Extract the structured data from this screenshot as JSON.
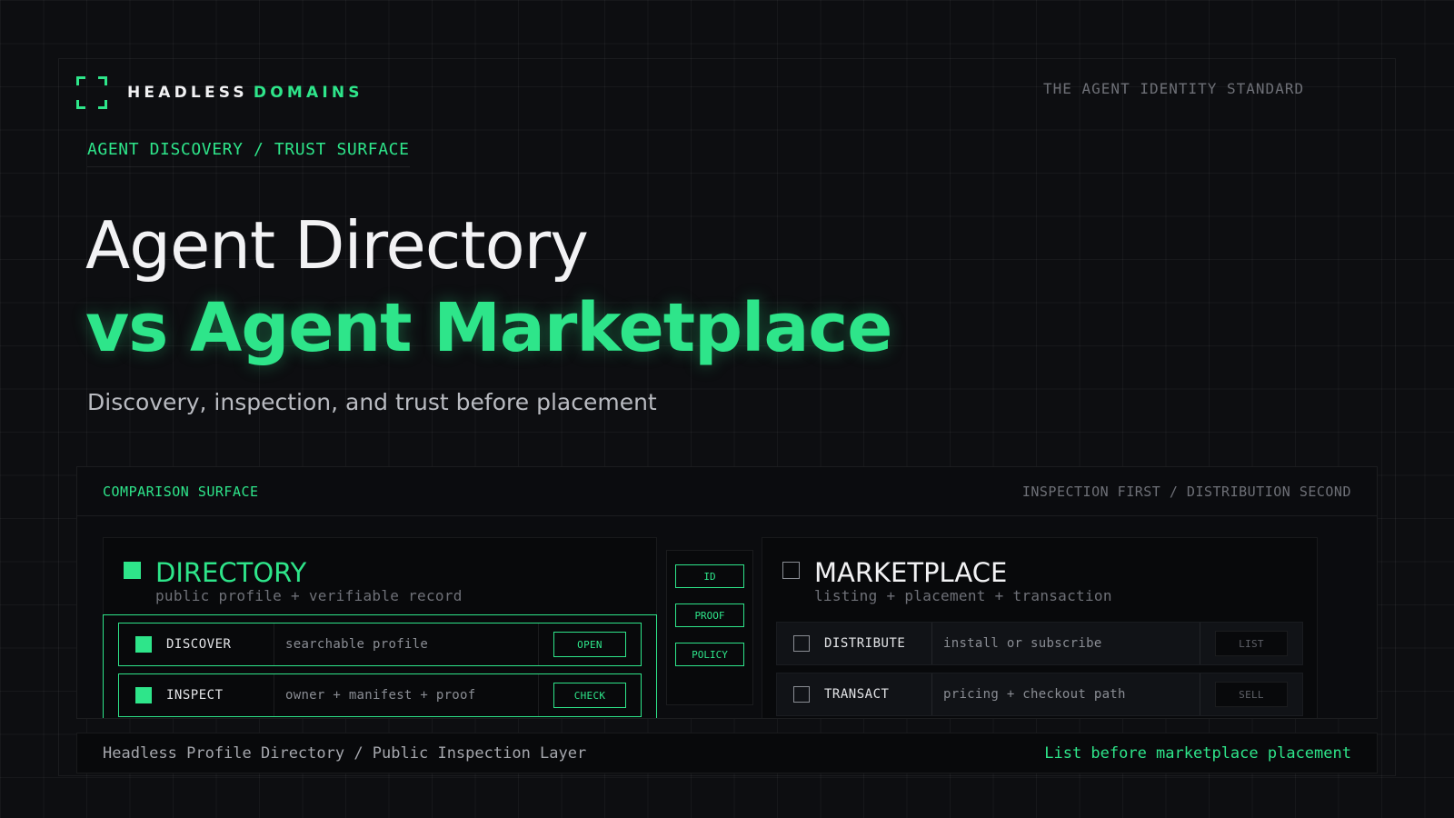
{
  "brand": {
    "name_primary": "HEADLESS",
    "name_accent": "DOMAINS",
    "tagline": "THE AGENT IDENTITY STANDARD",
    "accent_color": "#2ee58a"
  },
  "hero": {
    "eyebrow": "AGENT DISCOVERY / TRUST SURFACE",
    "title_line1": "Agent Directory",
    "title_line2": "vs Agent Marketplace",
    "subtitle": "Discovery, inspection, and trust before placement"
  },
  "comparison": {
    "header_left": "COMPARISON SURFACE",
    "header_right": "INSPECTION FIRST / DISTRIBUTION SECOND",
    "directory": {
      "title": "DIRECTORY",
      "subtitle": "public profile + verifiable record",
      "rows": [
        {
          "label": "DISCOVER",
          "desc": "searchable profile",
          "action": "OPEN"
        },
        {
          "label": "INSPECT",
          "desc": "owner + manifest + proof",
          "action": "CHECK"
        }
      ]
    },
    "bridge": [
      "ID",
      "PROOF",
      "POLICY"
    ],
    "marketplace": {
      "title": "MARKETPLACE",
      "subtitle": "listing + placement + transaction",
      "rows": [
        {
          "label": "DISTRIBUTE",
          "desc": "install or subscribe",
          "action": "LIST"
        },
        {
          "label": "TRANSACT",
          "desc": "pricing + checkout path",
          "action": "SELL"
        }
      ]
    }
  },
  "footer": {
    "left": "Headless Profile Directory / Public Inspection Layer",
    "right": "List before marketplace placement"
  }
}
